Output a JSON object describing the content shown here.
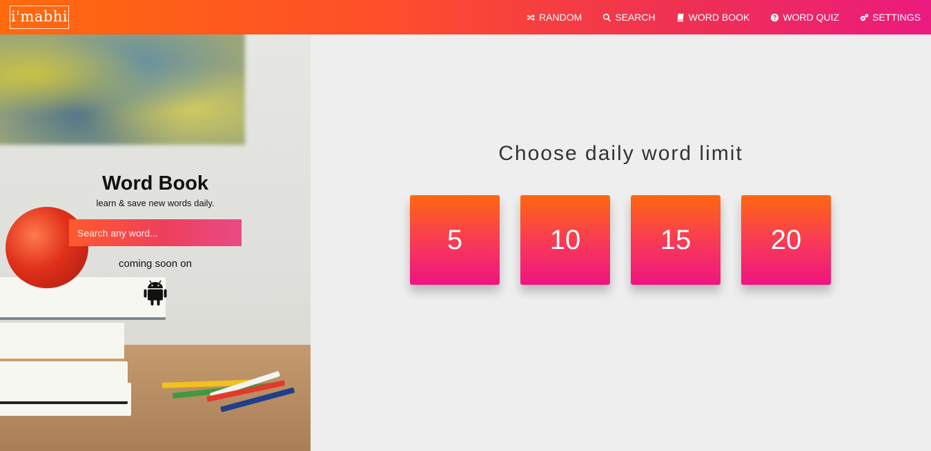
{
  "header": {
    "logo_text": "i'mabhi",
    "nav": [
      {
        "label": "RANDOM",
        "icon": "shuffle-icon"
      },
      {
        "label": "SEARCH",
        "icon": "search-icon"
      },
      {
        "label": "WORD BOOK",
        "icon": "book-icon"
      },
      {
        "label": "WORD QUIZ",
        "icon": "question-circle-icon"
      },
      {
        "label": "SETTINGS",
        "icon": "gears-icon"
      }
    ],
    "colors": {
      "gradient_start": "#ff6a0c",
      "gradient_end": "#ec1a7f"
    }
  },
  "hero": {
    "title": "Word Book",
    "subtitle": "learn & save new words daily.",
    "search_placeholder": "Search any word...",
    "coming_soon": "coming soon on",
    "platform_icon": "android-icon"
  },
  "main": {
    "title": "Choose daily word limit",
    "options": [
      "5",
      "10",
      "15",
      "20"
    ]
  }
}
